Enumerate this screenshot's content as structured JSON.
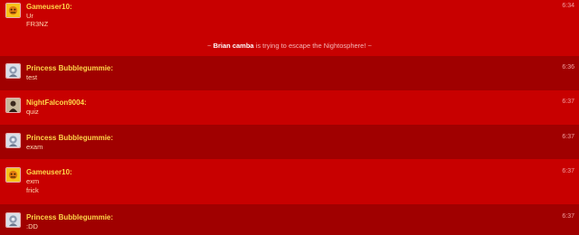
{
  "messages": [
    {
      "author": "Gameuser10:",
      "lines": [
        "Ur",
        "FR3NZ"
      ],
      "time": "6:34",
      "avatar": "cartoon-avatar"
    },
    {
      "author": "Princess Bubblegummie:",
      "lines": [
        "test"
      ],
      "time": "6:36",
      "avatar": "character-avatar"
    },
    {
      "author": "NightFalcon9004:",
      "lines": [
        "quiz"
      ],
      "time": "6:37",
      "avatar": "dark-character-avatar"
    },
    {
      "author": "Princess Bubblegummie:",
      "lines": [
        "exam"
      ],
      "time": "6:37",
      "avatar": "character-avatar"
    },
    {
      "author": "Gameuser10:",
      "lines": [
        "exm",
        "frick"
      ],
      "time": "6:37",
      "avatar": "cartoon-avatar"
    },
    {
      "author": "Princess Bubblegummie:",
      "lines": [
        ":DD"
      ],
      "time": "6:37",
      "avatar": "character-avatar"
    }
  ],
  "system_notice": {
    "prefix": "~ ",
    "name": "Brian camba",
    "text": " is trying to escape the Nightosphere! ~"
  },
  "colors": {
    "row_light": "#c80000",
    "row_dark": "#a00000",
    "author": "#ffd84a",
    "message_text": "#ffd9b3",
    "timestamp": "#f2a0a0"
  }
}
